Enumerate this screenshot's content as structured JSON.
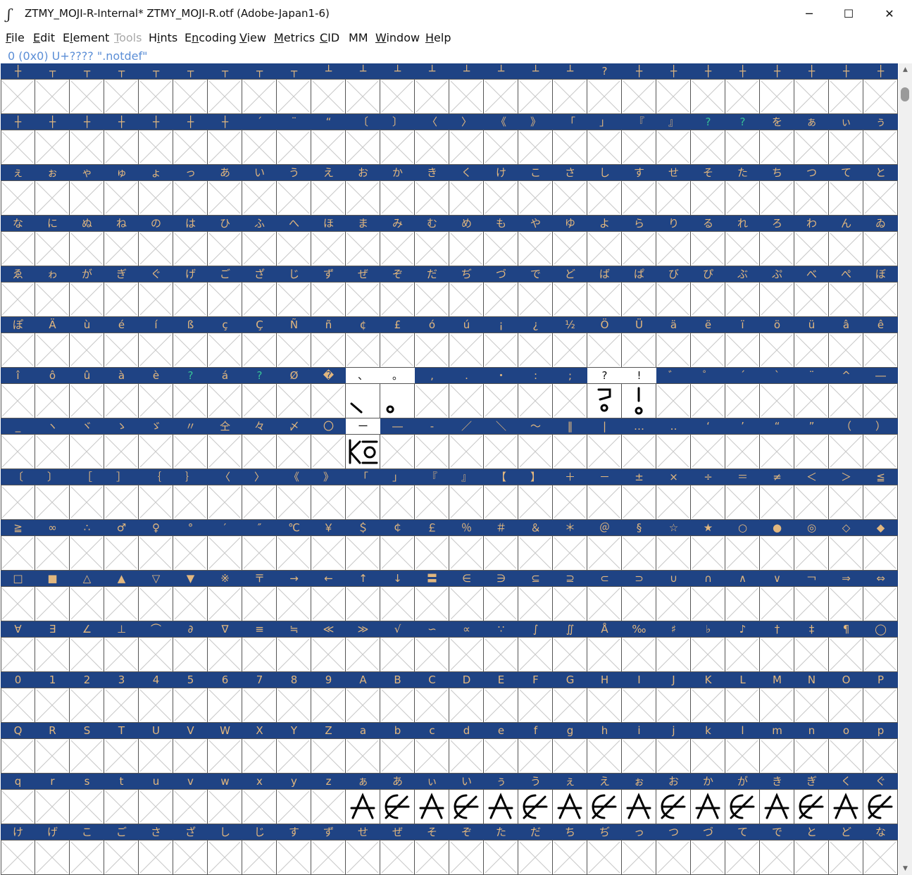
{
  "window": {
    "title": "ZTMY_MOJI-R-Internal*  ZTMY_MOJI-R.otf (Adobe-Japan1-6)",
    "minimize": "─",
    "maximize": "☐",
    "close": "✕"
  },
  "menu": [
    {
      "label": "File",
      "key": "F",
      "pos": 0
    },
    {
      "label": "Edit",
      "key": "E",
      "pos": 0
    },
    {
      "label": "Element",
      "key": "l",
      "pos": 1
    },
    {
      "label": "Tools",
      "key": "T",
      "pos": 0,
      "disabled": true
    },
    {
      "label": "Hints",
      "key": "i",
      "pos": 1
    },
    {
      "label": "Encoding",
      "key": "n",
      "pos": 1
    },
    {
      "label": "View",
      "key": "V",
      "pos": 0
    },
    {
      "label": "Metrics",
      "key": "M",
      "pos": 0
    },
    {
      "label": "CID",
      "key": "C",
      "pos": 0
    },
    {
      "label": "MM",
      "key": "",
      "pos": -1
    },
    {
      "label": "Window",
      "key": "W",
      "pos": 0
    },
    {
      "label": "Help",
      "key": "H",
      "pos": 0
    }
  ],
  "status": "0 (0x0) U+???? \".notdef\"",
  "glyph_grid": {
    "label_colors": {
      "normal": "#e2b77e",
      "unmapped": "#37c397",
      "header": "#1f4384"
    },
    "rows": [
      [
        "┼",
        "┬",
        "┬",
        "┬",
        "┬",
        "┬",
        "┬",
        "┬",
        "┬",
        "┴",
        "┴",
        "┴",
        "┴",
        "┴",
        "┴",
        "┴",
        "┴",
        "?",
        "┼",
        "┼",
        "┼",
        "┼",
        "┼",
        "┼",
        "┼",
        "┼"
      ],
      [
        "┼",
        "┼",
        "┼",
        "┼",
        "┼",
        "┼",
        "┼",
        "´",
        "¨",
        "“",
        "〔",
        "〕",
        "〈",
        "〉",
        "《",
        "》",
        "「",
        "」",
        "『",
        "』",
        "?",
        "?",
        "を",
        "ぁ",
        "ぃ",
        "ぅ"
      ],
      [
        "ぇ",
        "ぉ",
        "ゃ",
        "ゅ",
        "ょ",
        "っ",
        "あ",
        "い",
        "う",
        "え",
        "お",
        "か",
        "き",
        "く",
        "け",
        "こ",
        "さ",
        "し",
        "す",
        "せ",
        "そ",
        "た",
        "ち",
        "つ",
        "て",
        "と"
      ],
      [
        "な",
        "に",
        "ぬ",
        "ね",
        "の",
        "は",
        "ひ",
        "ふ",
        "へ",
        "ほ",
        "ま",
        "み",
        "む",
        "め",
        "も",
        "や",
        "ゆ",
        "よ",
        "ら",
        "り",
        "る",
        "れ",
        "ろ",
        "わ",
        "ん",
        "ゐ"
      ],
      [
        "ゑ",
        "ゎ",
        "が",
        "ぎ",
        "ぐ",
        "げ",
        "ご",
        "ざ",
        "じ",
        "ず",
        "ぜ",
        "ぞ",
        "だ",
        "ぢ",
        "づ",
        "で",
        "ど",
        "ば",
        "ぱ",
        "び",
        "ぴ",
        "ぶ",
        "ぷ",
        "べ",
        "ぺ",
        "ぼ"
      ],
      [
        "ぽ",
        "Ä",
        "ù",
        "é",
        "í",
        "ß",
        "ç",
        "Ç",
        "Ñ",
        "ñ",
        "¢",
        "£",
        "ó",
        "ú",
        "¡",
        "¿",
        "½",
        "Ö",
        "Ü",
        "ä",
        "ë",
        "ï",
        "ö",
        "ü",
        "â",
        "ê"
      ],
      [
        "î",
        "ô",
        "û",
        "à",
        "è",
        "?",
        "á",
        "?",
        "Ø",
        "�",
        "、",
        "。",
        ",",
        ".",
        "・",
        ":",
        ";",
        "?",
        "!",
        "゛",
        "゜",
        "´",
        "`",
        "¨",
        "^",
        "―"
      ],
      [
        "_",
        "ヽ",
        "ヾ",
        "ゝ",
        "ゞ",
        "〃",
        "仝",
        "々",
        "〆",
        "〇",
        "ー",
        "―",
        "-",
        "／",
        "＼",
        "～",
        "‖",
        "|",
        "…",
        "‥",
        "‘",
        "’",
        "“",
        "”",
        "（",
        "）"
      ],
      [
        "〔",
        "〕",
        "［",
        "］",
        "｛",
        "｝",
        "〈",
        "〉",
        "《",
        "》",
        "「",
        "」",
        "『",
        "』",
        "【",
        "】",
        "＋",
        "－",
        "±",
        "×",
        "÷",
        "＝",
        "≠",
        "＜",
        "＞",
        "≦"
      ],
      [
        "≧",
        "∞",
        "∴",
        "♂",
        "♀",
        "°",
        "′",
        "″",
        "℃",
        "￥",
        "＄",
        "￠",
        "￡",
        "％",
        "＃",
        "＆",
        "＊",
        "＠",
        "§",
        "☆",
        "★",
        "○",
        "●",
        "◎",
        "◇",
        "◆"
      ],
      [
        "□",
        "■",
        "△",
        "▲",
        "▽",
        "▼",
        "※",
        "〒",
        "→",
        "←",
        "↑",
        "↓",
        "〓",
        "∈",
        "∋",
        "⊆",
        "⊇",
        "⊂",
        "⊃",
        "∪",
        "∩",
        "∧",
        "∨",
        "￢",
        "⇒",
        "⇔"
      ],
      [
        "∀",
        "∃",
        "∠",
        "⊥",
        "⌒",
        "∂",
        "∇",
        "≡",
        "≒",
        "≪",
        "≫",
        "√",
        "∽",
        "∝",
        "∵",
        "∫",
        "∬",
        "Å",
        "‰",
        "♯",
        "♭",
        "♪",
        "†",
        "‡",
        "¶",
        "◯"
      ],
      [
        "0",
        "1",
        "2",
        "3",
        "4",
        "5",
        "6",
        "7",
        "8",
        "9",
        "A",
        "B",
        "C",
        "D",
        "E",
        "F",
        "G",
        "H",
        "I",
        "J",
        "K",
        "L",
        "M",
        "N",
        "O",
        "P"
      ],
      [
        "Q",
        "R",
        "S",
        "T",
        "U",
        "V",
        "W",
        "X",
        "Y",
        "Z",
        "a",
        "b",
        "c",
        "d",
        "e",
        "f",
        "g",
        "h",
        "i",
        "j",
        "k",
        "l",
        "m",
        "n",
        "o",
        "p"
      ],
      [
        "q",
        "r",
        "s",
        "t",
        "u",
        "v",
        "w",
        "x",
        "y",
        "z",
        "ぁ",
        "あ",
        "ぃ",
        "い",
        "ぅ",
        "う",
        "ぇ",
        "え",
        "ぉ",
        "お",
        "か",
        "が",
        "き",
        "ぎ",
        "く",
        "ぐ"
      ],
      [
        "け",
        "げ",
        "こ",
        "ご",
        "さ",
        "ざ",
        "し",
        "じ",
        "す",
        "ず",
        "せ",
        "ぜ",
        "そ",
        "ぞ",
        "た",
        "だ",
        "ち",
        "ぢ",
        "っ",
        "つ",
        "づ",
        "て",
        "で",
        "と",
        "ど",
        "な"
      ]
    ],
    "unmapped": [
      [
        1,
        20
      ],
      [
        1,
        21
      ],
      [
        6,
        5
      ],
      [
        6,
        7
      ]
    ],
    "highlighted": [
      [
        6,
        10
      ],
      [
        6,
        11
      ],
      [
        6,
        17
      ],
      [
        6,
        18
      ],
      [
        7,
        10
      ]
    ],
    "drawn": [
      [
        6,
        10
      ],
      [
        6,
        11
      ],
      [
        6,
        17
      ],
      [
        6,
        18
      ],
      [
        7,
        10
      ],
      [
        14,
        10
      ],
      [
        14,
        11
      ],
      [
        14,
        12
      ],
      [
        14,
        13
      ],
      [
        14,
        14
      ],
      [
        14,
        15
      ],
      [
        14,
        16
      ],
      [
        14,
        17
      ],
      [
        14,
        18
      ],
      [
        14,
        19
      ],
      [
        14,
        20
      ],
      [
        14,
        21
      ],
      [
        14,
        22
      ],
      [
        14,
        23
      ],
      [
        14,
        24
      ],
      [
        14,
        25
      ]
    ]
  }
}
